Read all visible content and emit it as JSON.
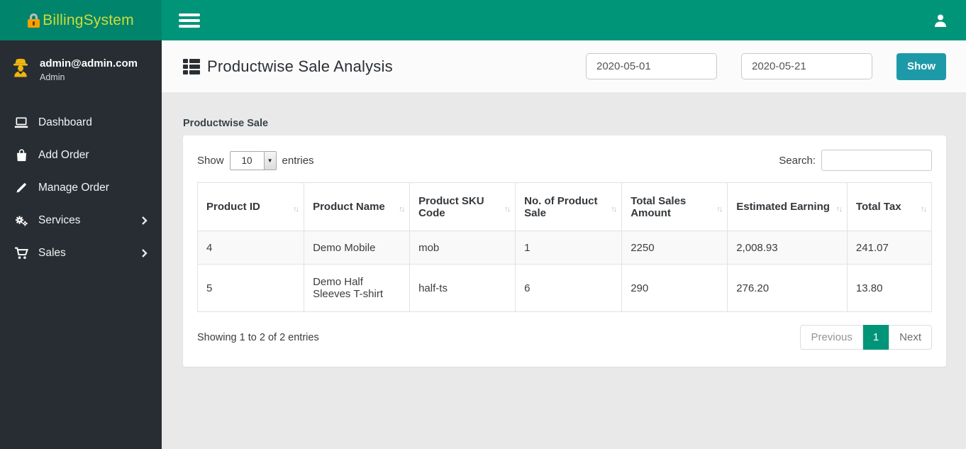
{
  "brand": {
    "name": "BillingSystem"
  },
  "sidebar": {
    "user": {
      "email": "admin@admin.com",
      "role": "Admin"
    },
    "items": [
      {
        "label": "Dashboard"
      },
      {
        "label": "Add Order"
      },
      {
        "label": "Manage Order"
      },
      {
        "label": "Services"
      },
      {
        "label": "Sales"
      }
    ]
  },
  "page_header": {
    "title": "Productwise Sale Analysis",
    "date_from": "2020-05-01",
    "date_to": "2020-05-21",
    "show_button": "Show"
  },
  "panel": {
    "title": "Productwise Sale",
    "length_before": "Show",
    "length_value": "10",
    "length_after": "entries",
    "search_label": "Search:",
    "search_value": "",
    "table": {
      "sort_icon": "↑↓",
      "columns": [
        "Product ID",
        "Product Name",
        "Product SKU Code",
        "No. of Product Sale",
        "Total Sales Amount",
        "Estimated Earning",
        "Total Tax"
      ],
      "rows": [
        [
          "4",
          "Demo Mobile",
          "mob",
          "1",
          "2250",
          "2,008.93",
          "241.07"
        ],
        [
          "5",
          "Demo Half Sleeves T-shirt",
          "half-ts",
          "6",
          "290",
          "276.20",
          "13.80"
        ]
      ]
    },
    "info": "Showing 1 to 2 of 2 entries",
    "pagination": {
      "previous": "Previous",
      "current": "1",
      "next": "Next"
    }
  },
  "colors": {
    "navbar": "#009579",
    "logo_bg": "#00846b",
    "sidebar_bg": "#272d33",
    "logo_text": "#cddc39",
    "accent_button": "#1d9aa8",
    "pagination_active": "#009579"
  }
}
